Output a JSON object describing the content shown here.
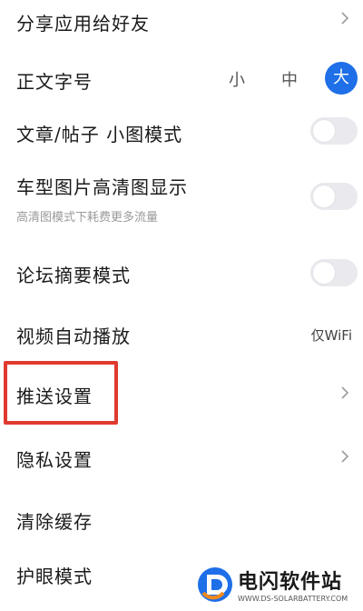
{
  "settings": {
    "share": {
      "label": "分享应用给好友"
    },
    "font_size": {
      "label": "正文字号",
      "options": [
        "小",
        "中",
        "大"
      ],
      "selected": "大",
      "accent_color": "#1e6fe8"
    },
    "small_image_mode": {
      "label": "文章/帖子 小图模式",
      "enabled": false
    },
    "hd_car_images": {
      "label": "车型图片高清图显示",
      "sub": "高清图模式下耗费更多流量",
      "enabled": false
    },
    "forum_summary": {
      "label": "论坛摘要模式",
      "enabled": false
    },
    "autoplay": {
      "label": "视频自动播放",
      "value": "仅WiFi"
    },
    "push": {
      "label": "推送设置",
      "highlight_color": "#e03a2f"
    },
    "privacy": {
      "label": "隐私设置"
    },
    "clear_cache": {
      "label": "清除缓存"
    },
    "eye_care": {
      "label": "护眼模式",
      "enabled": false
    }
  },
  "watermark": {
    "title": "电闪软件站",
    "url": "WWW.DS-SOLARBATTERY.COM"
  },
  "icons": [
    "chevron-right-icon",
    "toggle-switch",
    "watermark-logo-icon"
  ]
}
